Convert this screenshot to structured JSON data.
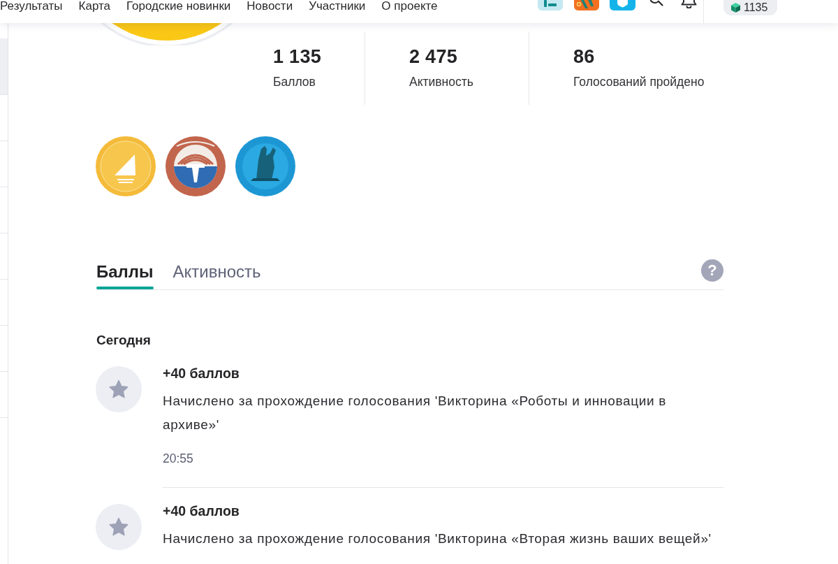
{
  "header": {
    "nav": [
      "Результаты",
      "Карта",
      "Городские новинки",
      "Новости",
      "Участники",
      "О проекте"
    ],
    "points": "1135"
  },
  "stats": [
    {
      "value": "1 135",
      "label": "Баллов"
    },
    {
      "value": "2 475",
      "label": "Активность"
    },
    {
      "value": "86",
      "label": "Голосований пройдено"
    }
  ],
  "tabs": [
    {
      "label": "Баллы",
      "selected": true
    },
    {
      "label": "Активность",
      "selected": false
    }
  ],
  "help": "?",
  "feed": {
    "date": "Сегодня",
    "entries": [
      {
        "title": "+40 баллов",
        "description": "Начислено за прохождение голосования 'Викторина «Роботы и инновации в архиве»'",
        "time": "20:55"
      },
      {
        "title": "+40 баллов",
        "description": "Начислено за прохождение голосования 'Викторина «Вторая жизнь ваших вещей»'"
      }
    ]
  }
}
